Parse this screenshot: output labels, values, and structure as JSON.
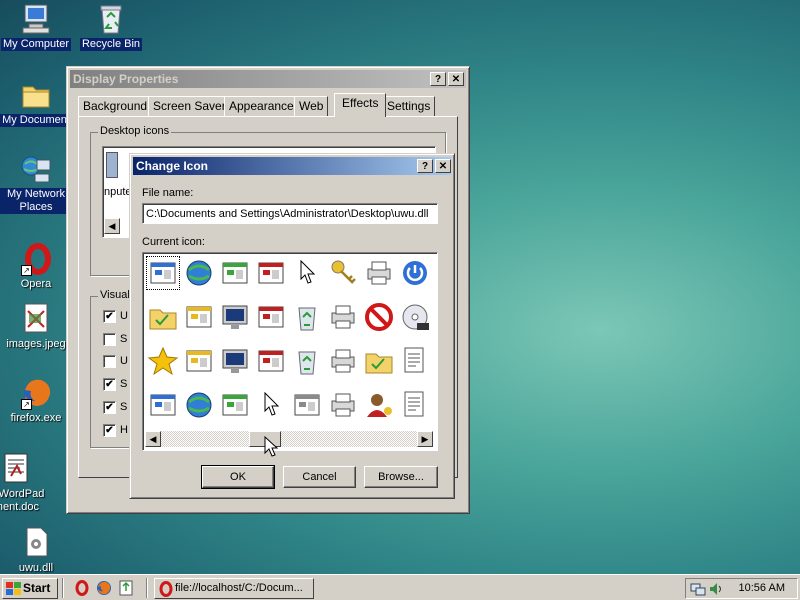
{
  "desktop": {
    "icons": [
      {
        "label": "My Computer"
      },
      {
        "label": "Recycle Bin"
      },
      {
        "label": "My Document"
      },
      {
        "label": "My Network Places"
      },
      {
        "label": "Opera"
      },
      {
        "label": "images.jpeg"
      },
      {
        "label": "firefox.exe"
      },
      {
        "label": "w WordPad\nument.doc"
      },
      {
        "label": "uwu.dll"
      }
    ]
  },
  "display_properties": {
    "title": "Display Properties",
    "help_button": "?",
    "close_button": "✕",
    "tabs": [
      "Background",
      "Screen Saver",
      "Appearance",
      "Web",
      "Effects",
      "Settings"
    ],
    "active_tab": "Effects",
    "desktop_icons_group": "Desktop icons",
    "partial_icon_label": "nputer",
    "visual_group": "Visual",
    "visual_options": [
      {
        "letter": "U",
        "checked": true
      },
      {
        "letter": "S",
        "checked": false
      },
      {
        "letter": "U",
        "checked": false
      },
      {
        "letter": "S",
        "checked": true
      },
      {
        "letter": "S",
        "checked": true
      },
      {
        "letter": "H",
        "checked": true
      }
    ]
  },
  "change_icon": {
    "title": "Change Icon",
    "help_button": "?",
    "close_button": "✕",
    "file_name_label": "File name:",
    "file_name_value": "C:\\Documents and Settings\\Administrator\\Desktop\\uwu.dll",
    "current_icon_label": "Current icon:",
    "ok_label": "OK",
    "cancel_label": "Cancel",
    "browse_label": "Browse...",
    "icons": [
      "org-chart-icon",
      "globe-icon",
      "network-computer-icon",
      "window-app-icon",
      "cursor-sparkle-icon",
      "keys-icon",
      "printer-network-icon",
      "power-icon",
      "network-folder-icon",
      "fax-icon",
      "monitor-icon",
      "window-list-icon",
      "recycle-bin-full-icon",
      "printer-icon",
      "no-entry-icon",
      "dvd-icon",
      "star-icon",
      "window-gear-icon",
      "display-icon",
      "window-tiles-icon",
      "recycle-bin-empty-icon",
      "printer-default-icon",
      "folder-check-icon",
      "documents-icon",
      "cardfile-icon",
      "frame-globe-icon",
      "window-grid-icon",
      "hand-pointer-icon",
      "network-share-icon",
      "printer-shared-icon",
      "user-key-icon",
      "film-document-icon"
    ]
  },
  "taskbar": {
    "start_label": "Start",
    "task_button_label": "file://localhost/C:/Docum...",
    "clock": "10:56 AM"
  }
}
